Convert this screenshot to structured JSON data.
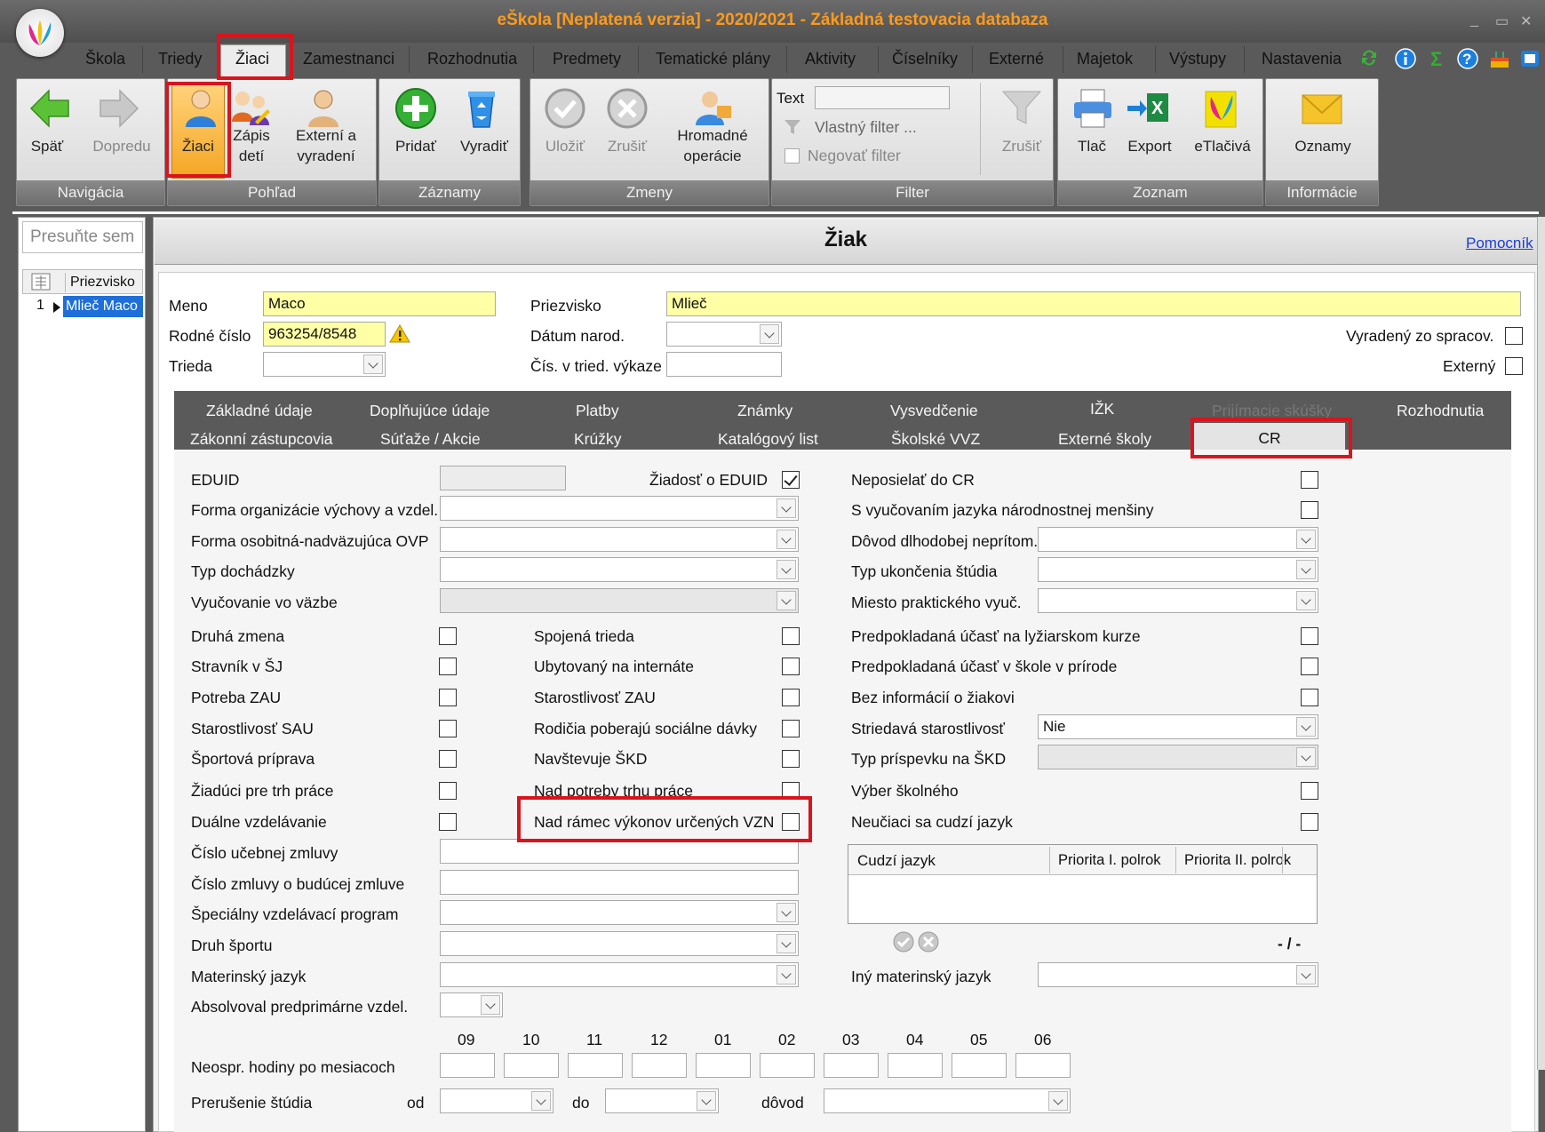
{
  "window": {
    "title": "eŠkola [Neplatená verzia] - 2020/2021 - Základná testovacia databaza",
    "controls": [
      "_",
      "▭",
      "✕"
    ]
  },
  "menu": [
    "Škola",
    "Triedy",
    "Žiaci",
    "Zamestnanci",
    "Rozhodnutia",
    "Predmety",
    "Tematické plány",
    "Aktivity",
    "Číselníky",
    "Externé",
    "Majetok",
    "Výstupy",
    "Nastavenia"
  ],
  "ribbon": {
    "navigacia": {
      "caption": "Navigácia",
      "spat": "Späť",
      "dopredu": "Dopredu"
    },
    "pohlad": {
      "caption": "Pohľad",
      "ziaci": "Žiaci",
      "zapis_l1": "Zápis",
      "zapis_l2": "detí",
      "externi_l1": "Externí a",
      "externi_l2": "vyradení"
    },
    "zaznamy": {
      "caption": "Záznamy",
      "pridat": "Pridať",
      "vyradit": "Vyradiť"
    },
    "zmeny": {
      "caption": "Zmeny",
      "ulozit": "Uložiť",
      "zrusit": "Zrušiť",
      "hrom_l1": "Hromadné",
      "hrom_l2": "operácie"
    },
    "filter": {
      "caption": "Filter",
      "text_label": "Text",
      "vlastny": "Vlastný filter ...",
      "negovat": "Negovať filter",
      "zrusit": "Zrušiť"
    },
    "zoznam": {
      "caption": "Zoznam",
      "tlac": "Tlač",
      "export": "Export",
      "etlaciva": "eTlačivá"
    },
    "informacie": {
      "caption": "Informácie",
      "oznamy": "Oznamy"
    }
  },
  "left": {
    "group_placeholder": "Presuňte sem",
    "col_header": "Priezvisko",
    "row_num": "1",
    "row_value": "Mlieč Maco"
  },
  "main": {
    "title": "Žiak",
    "help_link": "Pomocník",
    "meno_label": "Meno",
    "meno_value": "Maco",
    "priezvisko_label": "Priezvisko",
    "priezvisko_value": "Mlieč",
    "rc_label": "Rodné číslo",
    "rc_value": "963254/8548",
    "datum_label": "Dátum narod.",
    "vyradeny_label": "Vyradený zo spracov.",
    "trieda_label": "Trieda",
    "cis_label": "Čís. v tried. výkaze",
    "externy_label": "Externý"
  },
  "tabs_row1": [
    "Základné údaje",
    "Doplňujúce údaje",
    "Platby",
    "Známky",
    "Vysvedčenie",
    "IŽK",
    "Prijímacie skúšky",
    "Rozhodnutia"
  ],
  "tabs_row2": [
    "Zákonní zástupcovia",
    "Súťaže / Akcie",
    "Krúžky",
    "Katalógový list",
    "Školské VVZ",
    "Externé školy",
    "CR"
  ],
  "cr": {
    "eduid": "EDUID",
    "ziadost_eduid": "Žiadosť o EDUID",
    "neposielat": "Neposielať do CR",
    "narodnostnej": "S vyučovaním jazyka národnostnej menšiny",
    "forma_org": "Forma organizácie výchovy a vzdel.",
    "forma_osob": "Forma osobitná-nadväzujúca OVP",
    "typ_doch": "Typ dochádzky",
    "vyuc_vazbe": "Vyučovanie vo väzbe",
    "dovod_nepr": "Dôvod dlhodobej neprítom.",
    "typ_ukonc": "Typ ukončenia štúdia",
    "miesto_prakt": "Miesto praktického vyuč.",
    "col1": [
      "Druhá zmena",
      "Stravník v ŠJ",
      "Potreba ZAU",
      "Starostlivosť SAU",
      "Športová príprava",
      "Žiadúci pre trh práce",
      "Duálne vzdelávanie"
    ],
    "col2": [
      "Spojená trieda",
      "Ubytovaný na internáte",
      "Starostlivosť ZAU",
      "Rodičia poberajú sociálne dávky",
      "Navštevuje ŠKD",
      "Nad potreby trhu práce",
      "Nad rámec výkonov určených VZN"
    ],
    "col3_lyz": "Predpokladaná účasť na lyžiarskom kurze",
    "col3_priroda": "Predpokladaná účasť v škole v prírode",
    "col3_bez": "Bez informácií o žiakovi",
    "striedava": "Striedavá starostlivosť",
    "striedava_value": "Nie",
    "typ_prisp": "Typ príspevku na ŠKD",
    "vyber_skolneho": "Výber školného",
    "neuciaci": "Neučiaci sa cudzí jazyk",
    "grid_cols": [
      "Cudzí jazyk",
      "Priorita I. polrok",
      "Priorita II. polrok"
    ],
    "grid_counter": "- / -",
    "cislo_ucebnej": "Číslo učebnej zmluvy",
    "cislo_buducej": "Číslo zmluvy o budúcej zmluve",
    "specialny": "Špeciálny vzdelávací program",
    "druh_sportu": "Druh športu",
    "materinsky": "Materinský jazyk",
    "iny_materinsky": "Iný materinský jazyk",
    "absolvoval": "Absolvoval predprimárne vzdel.",
    "months": [
      "09",
      "10",
      "11",
      "12",
      "01",
      "02",
      "03",
      "04",
      "05",
      "06"
    ],
    "neospr": "Neospr. hodiny po mesiacoch",
    "prerusenie": "Prerušenie štúdia",
    "od": "od",
    "do": "do",
    "dovod": "dôvod"
  },
  "colors": {
    "highlight_red": "#d8141d",
    "required_yellow": "#ffffa6",
    "title_orange": "#ff9a1a",
    "selected_blue": "#1e6fd9"
  }
}
